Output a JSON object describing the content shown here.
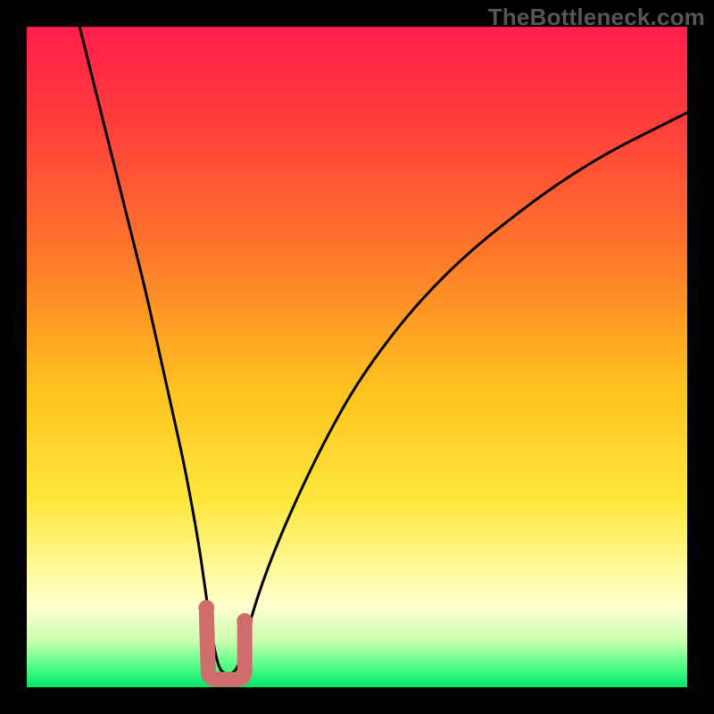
{
  "watermark": "TheBottleneck.com",
  "colors": {
    "black": "#000000",
    "curve": "#000000",
    "marker": "#cf6c6c",
    "gradient_stops": [
      {
        "offset": 0.0,
        "color": "#ff1e4a"
      },
      {
        "offset": 0.15,
        "color": "#ff3f3b"
      },
      {
        "offset": 0.35,
        "color": "#ff7a2b"
      },
      {
        "offset": 0.55,
        "color": "#ffc21f"
      },
      {
        "offset": 0.72,
        "color": "#ffe83e"
      },
      {
        "offset": 0.82,
        "color": "#fff99a"
      },
      {
        "offset": 0.88,
        "color": "#fdffd0"
      },
      {
        "offset": 0.93,
        "color": "#caffad"
      },
      {
        "offset": 0.965,
        "color": "#5dff8a"
      },
      {
        "offset": 1.0,
        "color": "#00e66a"
      }
    ]
  },
  "chart_data": {
    "type": "line",
    "title": "",
    "xlabel": "",
    "ylabel": "",
    "xlim": [
      0,
      100
    ],
    "ylim": [
      0,
      100
    ],
    "series": [
      {
        "name": "bottleneck-curve",
        "x": [
          8,
          10,
          12,
          14,
          16,
          18,
          20,
          22,
          24,
          26,
          27,
          28,
          29,
          30,
          31,
          32,
          33,
          35,
          38,
          42,
          46,
          50,
          55,
          60,
          66,
          72,
          80,
          88,
          96,
          100
        ],
        "y": [
          100,
          92,
          84,
          76,
          68,
          60,
          51,
          42,
          33,
          22,
          15,
          8,
          3,
          2,
          2,
          3,
          7,
          14,
          22,
          31,
          39,
          46,
          53,
          59,
          65,
          70,
          76,
          81,
          85,
          87
        ]
      }
    ],
    "annotations": [
      {
        "name": "left-marker-dot",
        "x": 27.2,
        "y": 12
      },
      {
        "name": "right-marker-dot",
        "x": 33.0,
        "y": 10
      },
      {
        "name": "u-bottom",
        "x": 30.0,
        "y": 2
      }
    ]
  }
}
